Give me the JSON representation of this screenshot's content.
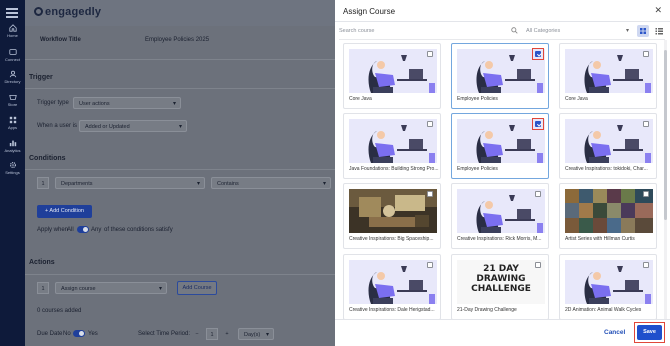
{
  "nav": {
    "items": [
      {
        "label": "Home",
        "icon": "home-icon"
      },
      {
        "label": "Connect",
        "icon": "connect-icon"
      },
      {
        "label": "Directory",
        "icon": "directory-icon"
      },
      {
        "label": "Store",
        "icon": "store-icon"
      },
      {
        "label": "Apps",
        "icon": "apps-icon"
      },
      {
        "label": "Analytics",
        "icon": "analytics-icon"
      },
      {
        "label": "Settings",
        "icon": "settings-icon"
      }
    ]
  },
  "brand": {
    "name": "engagedly"
  },
  "workflow": {
    "title_label": "Workflow Title",
    "title_value": "Employee Policies 2025",
    "trigger_heading": "Trigger",
    "trigger_type_label": "Trigger type",
    "trigger_type_value": "User actions",
    "when_label": "When a user is",
    "when_value": "Added or Updated",
    "conditions_heading": "Conditions",
    "condition_number": "1",
    "condition_field": "Departments",
    "condition_operator": "Contains",
    "add_condition": "+ Add Condition",
    "apply_prefix": "Apply when",
    "apply_all": "All",
    "apply_any": "Any",
    "apply_suffix": "of these conditions satisfy",
    "actions_heading": "Actions",
    "action_number": "1",
    "action_value": "Assign course",
    "add_course": "Add Course",
    "courses_added": "0 courses added",
    "due_date_label": "Due Date",
    "due_no": "No",
    "due_yes": "Yes",
    "period_label": "Select Time Period:",
    "period_minus": "−",
    "period_value": "1",
    "period_plus": "+",
    "period_unit": "Day(s)"
  },
  "modal": {
    "title": "Assign Course",
    "close": "✕",
    "search_placeholder": "Search course",
    "category_value": "All Categories",
    "cancel": "Cancel",
    "save": "Save",
    "courses": [
      {
        "name": "Core Java",
        "selected": false,
        "thumb": "illustration"
      },
      {
        "name": "Employee Policies",
        "selected": true,
        "thumb": "illustration"
      },
      {
        "name": "Core Java",
        "selected": false,
        "thumb": "illustration"
      },
      {
        "name": "Java Foundations: Building Strong Pro...",
        "selected": false,
        "thumb": "illustration"
      },
      {
        "name": "Employee Policies",
        "selected": true,
        "thumb": "illustration"
      },
      {
        "name": "Creative Inspirations: tokidoki, Char...",
        "selected": false,
        "thumb": "illustration"
      },
      {
        "name": "Creative Inspirations: Big Spaceship...",
        "selected": false,
        "thumb": "photo"
      },
      {
        "name": "Creative Inspirations: Rick Morris, M...",
        "selected": false,
        "thumb": "illustration"
      },
      {
        "name": "Artist Series with Hillman Curtis",
        "selected": false,
        "thumb": "collage"
      },
      {
        "name": "Creative Inspirations: Dale Herigstad...",
        "selected": false,
        "thumb": "illustration"
      },
      {
        "name": "21-Day Drawing Challenge",
        "selected": false,
        "thumb": "drawing",
        "thumb_text": "21 DAY DRAWING CHALLENGE"
      },
      {
        "name": "2D Animation: Animal Walk Cycles",
        "selected": false,
        "thumb": "illustration"
      }
    ]
  },
  "colors": {
    "accent": "#1f4fcc",
    "highlight": "#e0473a",
    "selected_border": "#74a7de"
  }
}
